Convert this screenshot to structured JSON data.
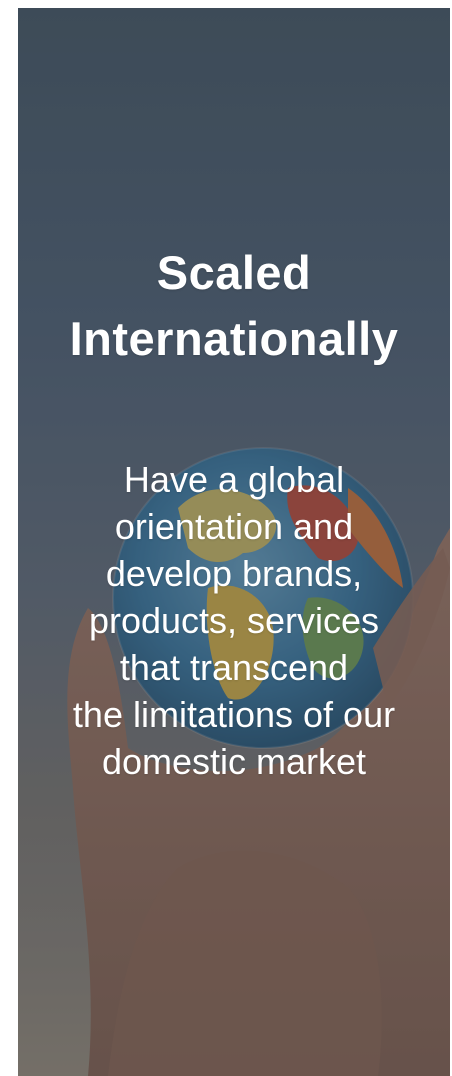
{
  "card": {
    "title_lines": [
      "Scaled",
      "Internationally"
    ],
    "body_lines": [
      "Have a global",
      "orientation and",
      "develop brands,",
      "products, services",
      "that transcend",
      "the limitations of our",
      "domestic market"
    ]
  },
  "colors": {
    "overlay": "#28323c",
    "text": "#ffffff"
  },
  "icons": {
    "background_image": "hand-holding-globe-photo"
  }
}
